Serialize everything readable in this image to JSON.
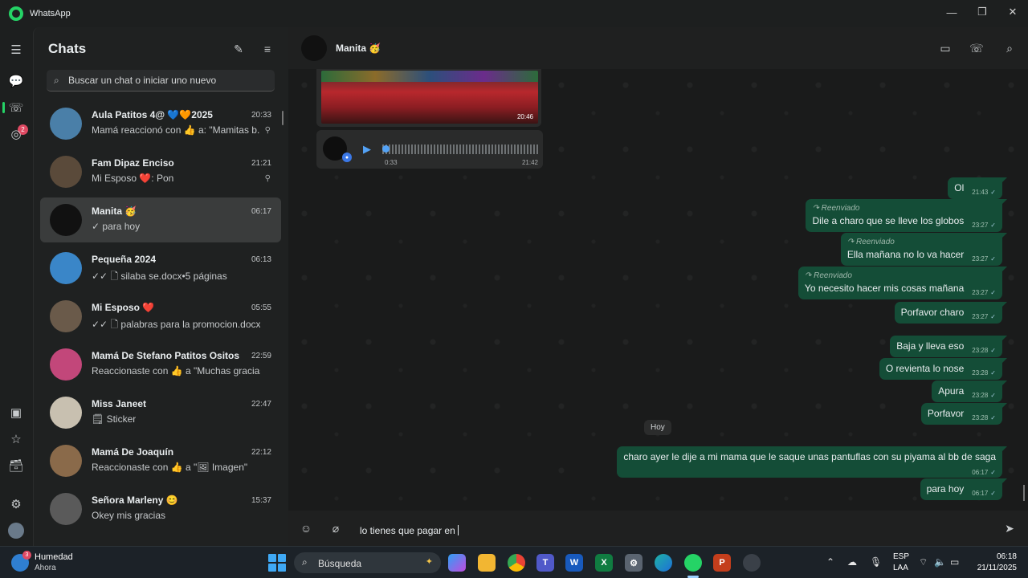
{
  "window": {
    "title": "WhatsApp",
    "minimize": "—",
    "maximize": "❐",
    "close": "✕"
  },
  "rail": {
    "calls_badge": "2"
  },
  "chat_list": {
    "title": "Chats",
    "search_placeholder": "Buscar un chat o iniciar uno nuevo",
    "chats": [
      {
        "name": "Aula Patitos 4@ 💙🧡2025",
        "time": "20:33",
        "preview": "Mamá reaccionó con 👍 a: \"Mamitas b...",
        "pinned": true,
        "avatar_color": "#4a7fa8"
      },
      {
        "name": "Fam Dipaz Enciso",
        "time": "21:21",
        "preview": "Mi Esposo ❤️: Pon",
        "pinned": true,
        "avatar_color": "#5a4a3a"
      },
      {
        "name": "Manita 🥳",
        "time": "06:17",
        "preview": "✓ para hoy",
        "pinned": false,
        "avatar_color": "#111111"
      },
      {
        "name": "Pequeña 2024",
        "time": "06:13",
        "preview": "✓✓ 🗋 silaba se.docx•5 páginas",
        "pinned": false,
        "avatar_color": "#3a86c8"
      },
      {
        "name": "Mi Esposo ❤️",
        "time": "05:55",
        "preview": "✓✓ 🗋 palabras para la promocion.docx",
        "pinned": false,
        "avatar_color": "#6a5a4a"
      },
      {
        "name": "Mamá De Stefano Patitos Ositos",
        "time": "22:59",
        "preview": "Reaccionaste con 👍 a \"Muchas gracias...",
        "pinned": false,
        "avatar_color": "#c2477a"
      },
      {
        "name": "Miss Janeet",
        "time": "22:47",
        "preview": "🗒 Sticker",
        "pinned": false,
        "avatar_color": "#c8c0b0"
      },
      {
        "name": "Mamá De Joaquín",
        "time": "22:12",
        "preview": "Reaccionaste con 👍 a \"🖼 Imagen\"",
        "pinned": false,
        "avatar_color": "#8a6a4a"
      },
      {
        "name": "Señora Marleny 😊",
        "time": "15:37",
        "preview": "Okey mis gracias",
        "pinned": false,
        "avatar_color": "#5a5a5a"
      }
    ]
  },
  "conversation": {
    "contact_name": "Manita 🥳",
    "image_time": "20:46",
    "audio": {
      "duration": "0:33",
      "time": "21:42"
    },
    "day_chip": "Hoy",
    "messages": [
      {
        "text": "Ol",
        "time": "21:43",
        "forwarded": false
      },
      {
        "text": "Dile a charo que se lleve los globos",
        "time": "23:27",
        "forwarded": true
      },
      {
        "text": "Ella mañana no lo va hacer",
        "time": "23:27",
        "forwarded": true
      },
      {
        "text": "Yo necesito hacer mis cosas mañana",
        "time": "23:27",
        "forwarded": true
      },
      {
        "text": "Porfavor charo",
        "time": "23:27",
        "forwarded": false
      },
      {
        "text": "Baja y lleva eso",
        "time": "23:28",
        "forwarded": false
      },
      {
        "text": "O revienta lo nose",
        "time": "23:28",
        "forwarded": false
      },
      {
        "text": "Apura",
        "time": "23:28",
        "forwarded": false
      },
      {
        "text": "Porfavor",
        "time": "23:28",
        "forwarded": false
      },
      {
        "text": "charo ayer le dije a mi mama que le saque unas pantuflas con su piyama al bb de saga",
        "time": "06:17",
        "forwarded": false
      },
      {
        "text": "para hoy",
        "time": "06:17",
        "forwarded": false
      }
    ],
    "forwarded_label": "Reenviado",
    "composer_text": "lo tienes que pagar en"
  },
  "taskbar": {
    "weather_title": "Humedad",
    "weather_sub": "Ahora",
    "weather_badge": "3",
    "search_text": "Búsqueda",
    "lang_1": "ESP",
    "lang_2": "LAA",
    "clock_time": "06:18",
    "clock_date": "21/11/2025"
  }
}
